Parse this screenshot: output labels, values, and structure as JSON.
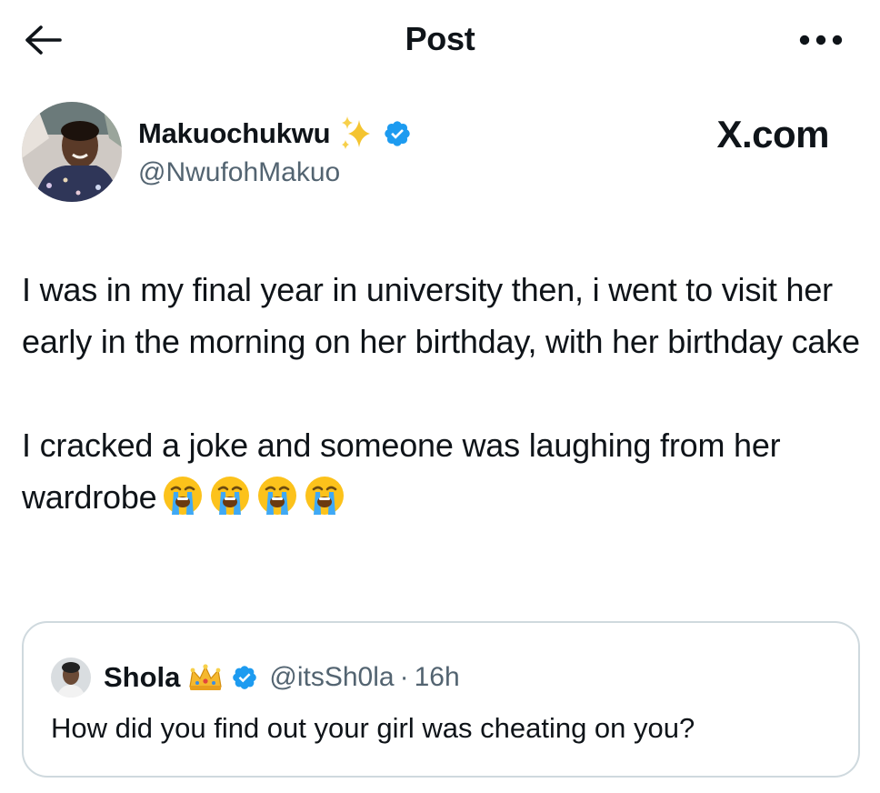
{
  "header": {
    "title": "Post",
    "back_icon": "arrow-left-icon",
    "more_icon": "more-horizontal-icon"
  },
  "author": {
    "name": "Makuochukwu",
    "handle": "@NwufohMakuo",
    "badges": [
      "sparkles-emoji",
      "verified-badge-icon"
    ]
  },
  "watermark": "X.com",
  "post": {
    "paragraph_1": "I was in my final year in university then, i went to visit her early in the morning on her birthday, with her birthday cake",
    "paragraph_2": "I cracked a joke and someone was laughing from her wardrobe",
    "emojis": [
      "loudly-crying-face",
      "loudly-crying-face",
      "loudly-crying-face",
      "loudly-crying-face"
    ]
  },
  "quote": {
    "name": "Shola",
    "handle": "@itsSh0la",
    "separator": "·",
    "time": "16h",
    "text": "How did you find out your girl was cheating on you?"
  },
  "colors": {
    "text": "#0f1419",
    "secondary": "#536471",
    "verified": "#1d9bf0",
    "border": "#cfd9de"
  }
}
